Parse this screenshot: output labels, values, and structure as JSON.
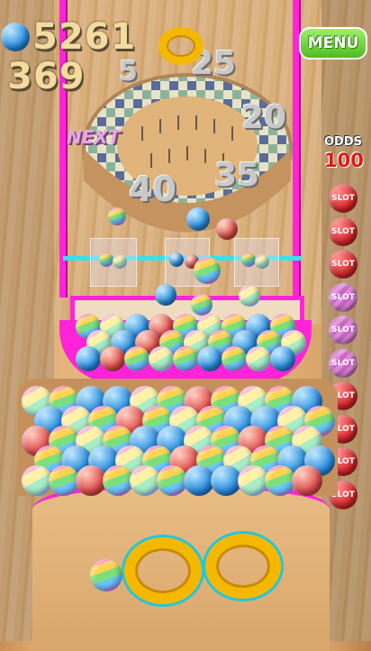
{
  "hud": {
    "score": "5261",
    "balls": "369",
    "menu_label": "MENU",
    "odds_label": "ODDS",
    "odds_value": "100",
    "next_label": "NEXT"
  },
  "board_numbers": [
    "5",
    "25",
    "20",
    "35",
    "40"
  ],
  "slots": [
    {
      "label": "SLOT",
      "color": "red"
    },
    {
      "label": "SLOT",
      "color": "red"
    },
    {
      "label": "SLOT",
      "color": "red"
    },
    {
      "label": "SLOT",
      "color": "pink"
    },
    {
      "label": "SLOT",
      "color": "pink"
    },
    {
      "label": "SLOT",
      "color": "pink"
    },
    {
      "label": "SLOT",
      "color": "red"
    },
    {
      "label": "SLOT",
      "color": "red"
    },
    {
      "label": "SLOT",
      "color": "red"
    },
    {
      "label": "SLOT",
      "color": "red"
    }
  ],
  "colors": {
    "magenta_frame": "#ff24d8",
    "menu_green": "#6ad43a",
    "odds_red": "#e01818",
    "ring_gold": "#f5b800",
    "ring_teal": "#22c7d8"
  }
}
